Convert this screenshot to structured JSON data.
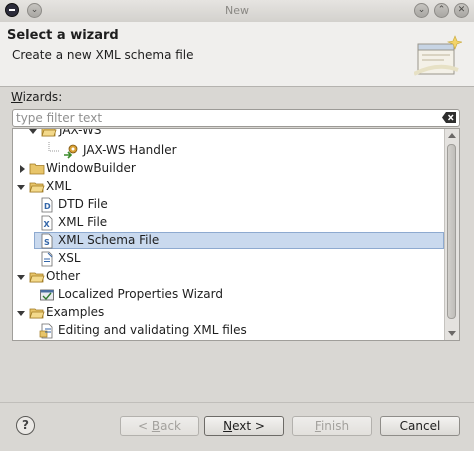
{
  "window": {
    "title": "New"
  },
  "header": {
    "title": "Select a wizard",
    "subtitle": "Create a new XML schema file"
  },
  "wizards_label_accel": "W",
  "wizards_label_rest": "izards:",
  "filter": {
    "placeholder": "type filter text",
    "value": ""
  },
  "tree": {
    "items": [
      {
        "label": "JAX-WS",
        "kind": "folder",
        "expanded": true,
        "partial": true
      },
      {
        "label": "JAX-WS Handler",
        "kind": "wizard"
      },
      {
        "label": "WindowBuilder",
        "kind": "folder",
        "expanded": false
      },
      {
        "label": "XML",
        "kind": "folder",
        "expanded": true
      },
      {
        "label": "DTD File",
        "kind": "file"
      },
      {
        "label": "XML File",
        "kind": "file"
      },
      {
        "label": "XML Schema File",
        "kind": "file",
        "selected": true
      },
      {
        "label": "XSL",
        "kind": "file"
      },
      {
        "label": "Other",
        "kind": "folder",
        "expanded": true
      },
      {
        "label": "Localized Properties Wizard",
        "kind": "wizard"
      },
      {
        "label": "Examples",
        "kind": "folder",
        "expanded": true
      },
      {
        "label": "Editing and validating XML files",
        "kind": "wizard"
      }
    ]
  },
  "buttons": {
    "back": "< Back",
    "next": "Next >",
    "finish": "Finish",
    "cancel": "Cancel"
  },
  "colors": {
    "selection": "#c9d9ee",
    "folder": "#e8c56a"
  }
}
